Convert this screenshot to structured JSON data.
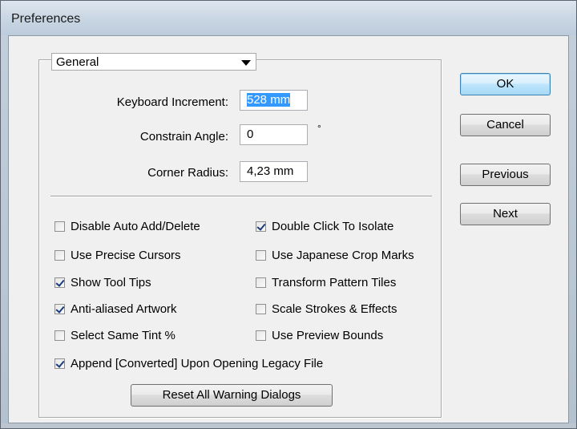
{
  "window": {
    "title": "Preferences"
  },
  "section_select": {
    "value": "General"
  },
  "fields": {
    "keyboard_increment": {
      "label": "Keyboard Increment:",
      "value": "528 mm"
    },
    "constrain_angle": {
      "label": "Constrain Angle:",
      "value": "0",
      "unit": "°"
    },
    "corner_radius": {
      "label": "Corner Radius:",
      "value": "4,23 mm"
    }
  },
  "checkboxes_left": [
    {
      "label": "Disable Auto Add/Delete",
      "checked": false
    },
    {
      "label": "Use Precise Cursors",
      "checked": false
    },
    {
      "label": "Show Tool Tips",
      "checked": true
    },
    {
      "label": "Anti-aliased Artwork",
      "checked": true
    },
    {
      "label": "Select Same Tint %",
      "checked": false
    }
  ],
  "checkboxes_right": [
    {
      "label": "Double Click To Isolate",
      "checked": true
    },
    {
      "label": "Use Japanese Crop Marks",
      "checked": false
    },
    {
      "label": "Transform Pattern Tiles",
      "checked": false
    },
    {
      "label": "Scale Strokes & Effects",
      "checked": false
    },
    {
      "label": "Use Preview Bounds",
      "checked": false
    }
  ],
  "append_converted": {
    "label": "Append [Converted] Upon Opening Legacy File",
    "checked": true
  },
  "buttons": {
    "reset_warnings": "Reset All Warning Dialogs",
    "ok": "OK",
    "cancel": "Cancel",
    "previous": "Previous",
    "next": "Next"
  }
}
